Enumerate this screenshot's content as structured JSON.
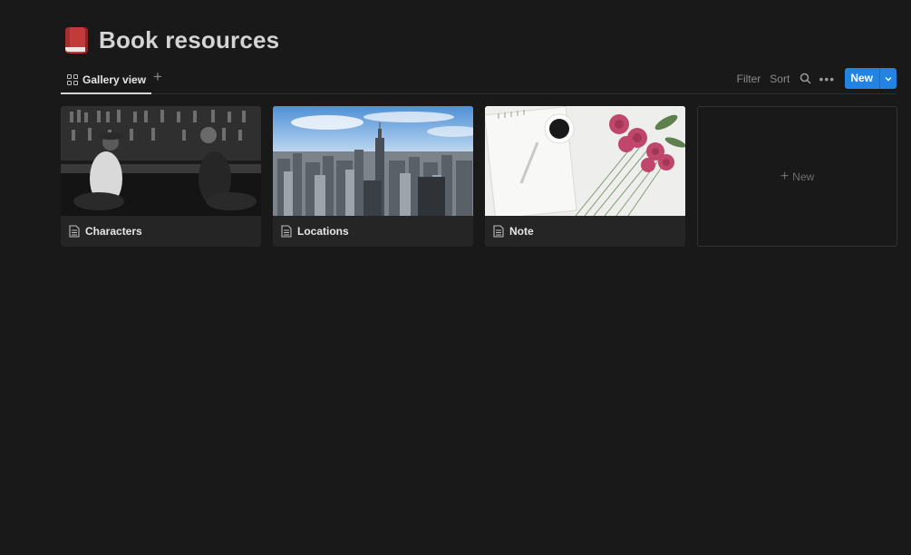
{
  "page": {
    "title": "Book resources",
    "icon": "red-book-icon"
  },
  "toolbar": {
    "views": [
      {
        "label": "Gallery view",
        "icon": "grid-icon",
        "active": true
      }
    ],
    "filter_label": "Filter",
    "sort_label": "Sort",
    "new_label": "New",
    "accent_color": "#2383e2"
  },
  "gallery": {
    "cards": [
      {
        "title": "Characters",
        "icon": "page-icon",
        "cover": "bar scene photo"
      },
      {
        "title": "Locations",
        "icon": "page-icon",
        "cover": "city skyline photo"
      },
      {
        "title": "Note",
        "icon": "page-icon",
        "cover": "notebook and roses photo"
      }
    ],
    "new_card_label": "New"
  }
}
